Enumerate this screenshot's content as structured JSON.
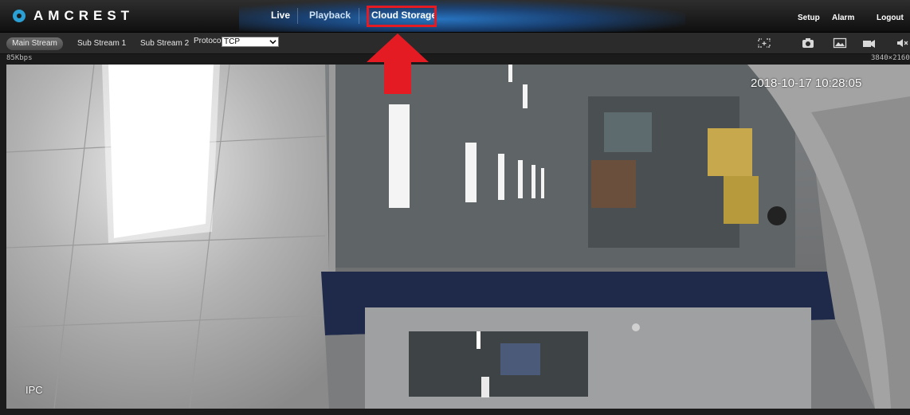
{
  "header": {
    "logo_text": "AMCREST",
    "nav": {
      "live": "Live",
      "playback": "Playback",
      "cloud_storage": "Cloud Storage"
    },
    "links": {
      "setup": "Setup",
      "alarm": "Alarm",
      "logout": "Logout"
    }
  },
  "toolbar": {
    "streams": {
      "main": "Main Stream",
      "sub1": "Sub Stream 1",
      "sub2": "Sub Stream 2"
    },
    "protocol_label": "Protocol",
    "protocol_value": "TCP",
    "icons": [
      "fullscreen-icon",
      "snapshot-camera-icon",
      "image-icon",
      "record-icon",
      "mute-icon"
    ]
  },
  "info": {
    "bitrate": "85Kbps",
    "resolution": "3840×2160"
  },
  "video": {
    "timestamp": "2018-10-17 10:28:05",
    "channel_label": "IPC"
  },
  "colors": {
    "accent_blue": "#2878c8",
    "highlight_red": "#e51b24",
    "logo_blue": "#2aa0d4"
  }
}
